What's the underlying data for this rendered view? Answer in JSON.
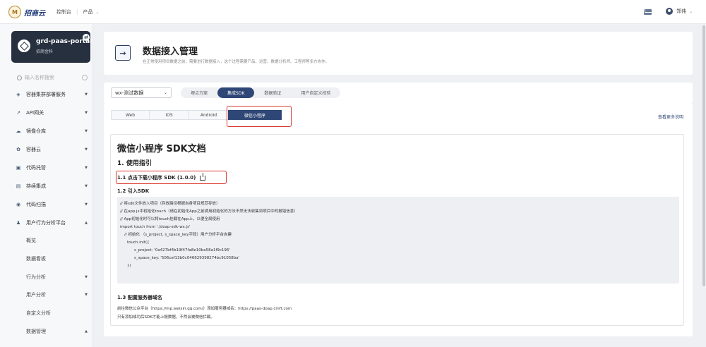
{
  "topbar": {
    "logo_badge": "M",
    "logo_text": "招商云",
    "nav": [
      "控制台",
      "产品"
    ],
    "user_name": "郑伟"
  },
  "sidebar": {
    "project": {
      "name": "grd-paas-portal",
      "sub": "招商金科"
    },
    "search_placeholder": "输入名称搜索",
    "items": [
      {
        "label": "容器集群部署服务",
        "icon": "cube-icon"
      },
      {
        "label": "API网关",
        "icon": "api-icon"
      },
      {
        "label": "镜像仓库",
        "icon": "cloud-icon"
      },
      {
        "label": "容器云",
        "icon": "container-icon"
      },
      {
        "label": "代码托管",
        "icon": "code-icon"
      },
      {
        "label": "持续集成",
        "icon": "build-icon"
      },
      {
        "label": "代码扫描",
        "icon": "scan-icon"
      },
      {
        "label": "用户行为分析平台",
        "icon": "users-icon"
      }
    ],
    "sub_items": [
      {
        "label": "概览",
        "caret": false
      },
      {
        "label": "数据看板",
        "caret": false
      },
      {
        "label": "行为分析",
        "caret": true
      },
      {
        "label": "用户分析",
        "caret": true
      },
      {
        "label": "自定义分析",
        "caret": false
      },
      {
        "label": "数据管理",
        "caret": true
      }
    ]
  },
  "header": {
    "title": "数据接入管理",
    "description": "在正常使用项目数据之前，需要进行数据接入，这个过程需要产品、运营、数据分析师、工程师等多方协作。"
  },
  "toolbar": {
    "env_value": "wx-测试数据",
    "pills": [
      "埋点方案",
      "集成SDK",
      "数据验证",
      "用户自定义校验"
    ],
    "active_pill": 1
  },
  "subtabs": {
    "items": [
      "Web",
      "IOS",
      "Android",
      "微信小程序"
    ],
    "active": 3,
    "more_link": "查看更多说明"
  },
  "doc": {
    "title": "微信小程序 SDK文档",
    "section1": "1. 使用指引",
    "download_line": "1.1 点击下载小程序 SDK (1.0.0)",
    "section12": "1.2 引入SDK",
    "code": [
      "// 将sdk文件放入项目（存放路径根据自身项目规范存放）",
      "// 在app.js中初始化touch（请在初始化App之前调用初始化的方法不然无法收集到项目中的报错信息）",
      "// App初始化时可以将touch挂载在App上，以便全局使用",
      "import touch from './doap-sdk-wx.js'",
      "    // 初始化 （s_project, s_space_key字段）用户分析平台自建",
      "    touch.init({",
      "        s_project: '0a427bf4b19f47fa8e10ba58a1f9c196'",
      "        s_space_key: '506cef13b0c046629398274bc91058ba'",
      "    })"
    ],
    "section13": "1.3 配置服务器域名",
    "p1": "前往微信公众平台（https://mp.weixin.qq.com/）添加服务器域名：https://paas-doap.cmft.com",
    "p2": "只有添加成功后SDK才能上报数据，不然会被微信拦截。"
  },
  "colors": {
    "primary": "#2e4776",
    "highlight": "#d9342b",
    "project_card": "#27303f"
  }
}
